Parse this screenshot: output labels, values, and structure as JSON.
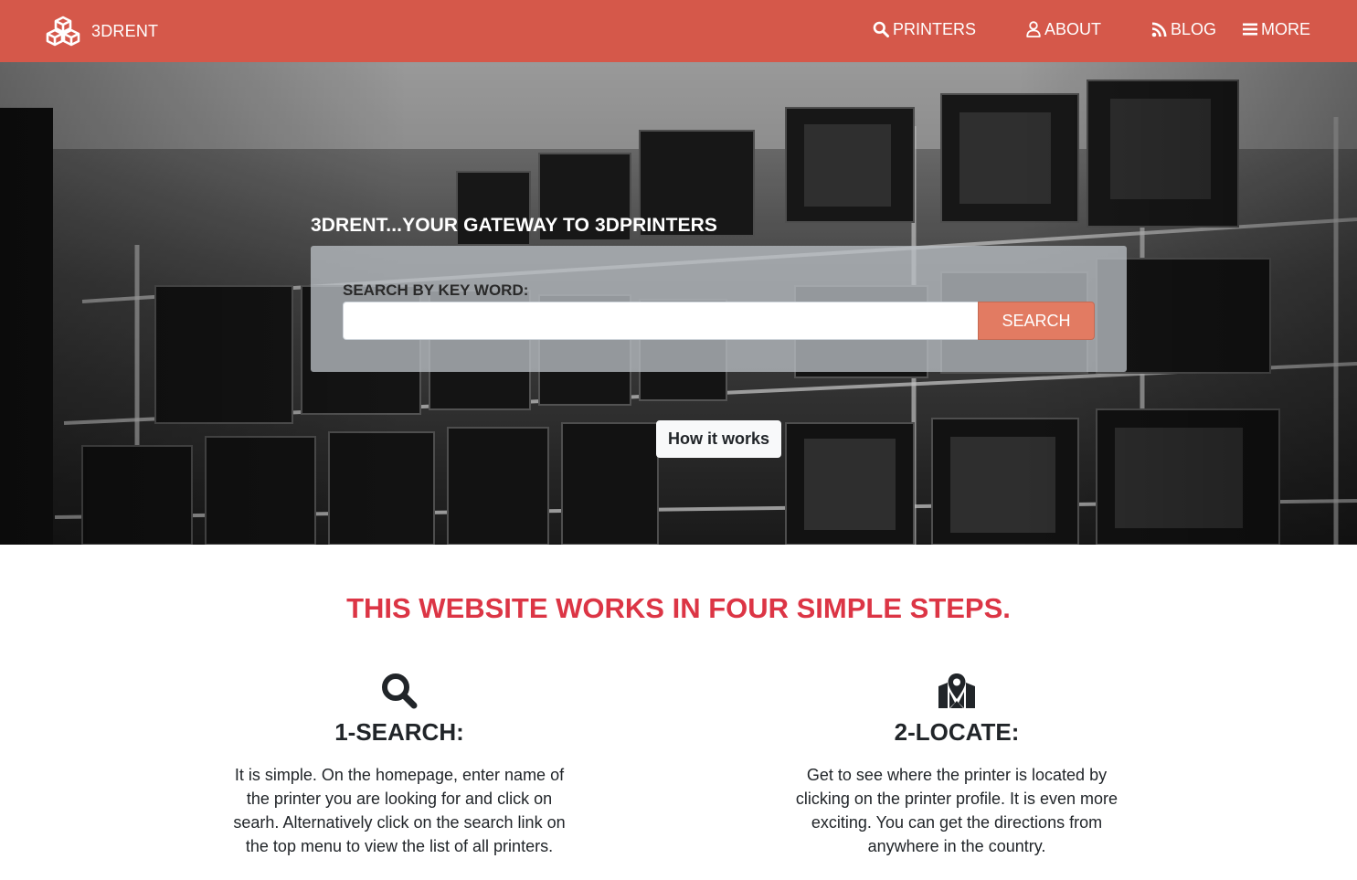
{
  "nav": {
    "brand": "3DRENT",
    "brand_icon": "cubes-icon",
    "brand_color": "#d5584a",
    "items": [
      {
        "label": "PRINTERS",
        "icon": "search-icon"
      },
      {
        "label": "ABOUT",
        "icon": "user-icon"
      },
      {
        "label": "BLOG",
        "icon": "rss-icon"
      },
      {
        "label": "MORE",
        "icon": "bars-icon"
      }
    ]
  },
  "hero": {
    "title": "3DRENT...YOUR GATEWAY TO 3DPRINTERS",
    "search_label": "SEARCH BY KEY WORD:",
    "search_value": "",
    "search_button": "SEARCH",
    "how_button": "How it works",
    "search_button_color": "#e27b62"
  },
  "steps": {
    "heading": "THIS WEBSITE WORKS IN FOUR SIMPLE STEPS.",
    "heading_color": "#dc3545",
    "items": [
      {
        "icon": "search-icon",
        "title": "1-SEARCH:",
        "text": "It is simple. On the homepage, enter name of the printer you are looking for and click on searh. Alternatively click on the search link on the top menu to view the list of all printers."
      },
      {
        "icon": "map-marker-icon",
        "title": "2-LOCATE:",
        "text": "Get to see where the printer is located by clicking on the printer profile. It is even more exciting. You can get the directions from anywhere in the country."
      }
    ]
  }
}
